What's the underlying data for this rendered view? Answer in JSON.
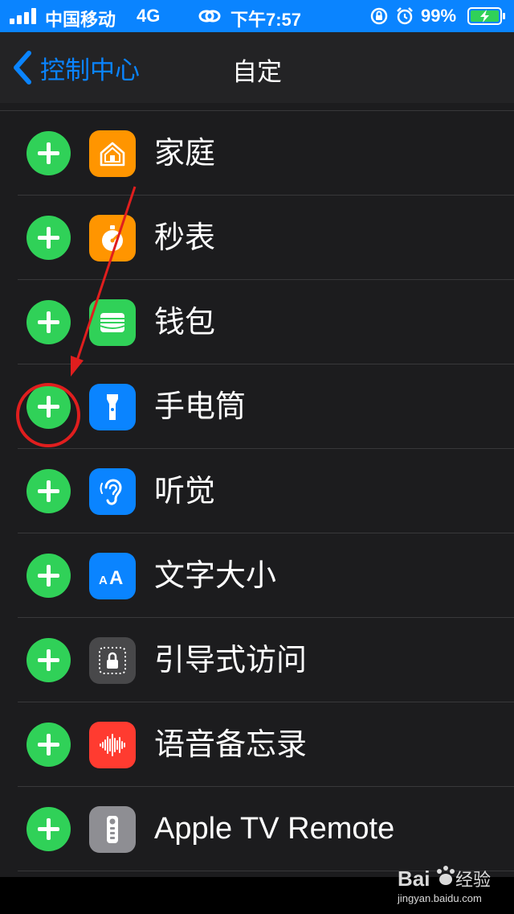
{
  "status_bar": {
    "carrier": "中国移动",
    "network": "4G",
    "time": "下午7:57",
    "battery_percent": "99%",
    "icons": [
      "signal-icon",
      "link-icon",
      "orientation-lock-icon",
      "alarm-icon",
      "battery-charging-icon"
    ]
  },
  "nav": {
    "back_label": "控制中心",
    "title": "自定"
  },
  "rows": [
    {
      "label": "家庭",
      "icon": "home-icon",
      "color": "#ff9500"
    },
    {
      "label": "秒表",
      "icon": "stopwatch-icon",
      "color": "#ff9500"
    },
    {
      "label": "钱包",
      "icon": "wallet-icon",
      "color": "#30d158"
    },
    {
      "label": "手电筒",
      "icon": "flashlight-icon",
      "color": "#0a84ff"
    },
    {
      "label": "听觉",
      "icon": "ear-icon",
      "color": "#0a84ff"
    },
    {
      "label": "文字大小",
      "icon": "text-size-icon",
      "color": "#0a84ff"
    },
    {
      "label": "引导式访问",
      "icon": "guided-access-icon",
      "color": "#48484a"
    },
    {
      "label": "语音备忘录",
      "icon": "voice-memos-icon",
      "color": "#ff3b30"
    },
    {
      "label": "Apple TV Remote",
      "icon": "tv-remote-icon",
      "color": "#8e8e93"
    }
  ],
  "colors": {
    "accent": "#0a84ff",
    "add_button": "#30d158",
    "background": "#1c1c1e",
    "annotation": "#e01e1e"
  },
  "icon_text": {
    "text_size_small": "A",
    "text_size_large": "A"
  }
}
